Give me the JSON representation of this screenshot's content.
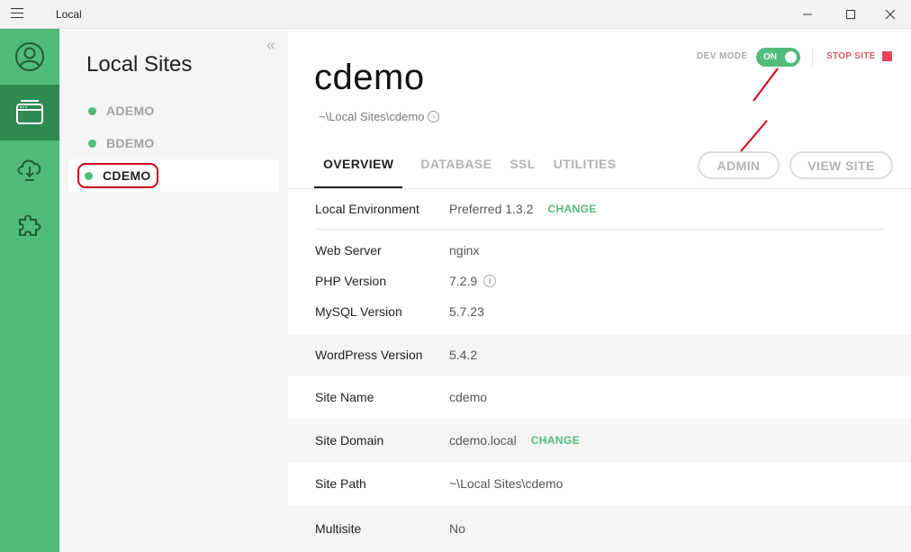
{
  "window": {
    "title": "Local"
  },
  "sidebar": {
    "heading": "Local Sites",
    "collapse_glyph": "«"
  },
  "sites": [
    {
      "name": "ADEMO"
    },
    {
      "name": "BDEMO"
    },
    {
      "name": "CDEMO"
    }
  ],
  "site": {
    "title": "cdemo",
    "path": "~\\Local Sites\\cdemo"
  },
  "header": {
    "dev_mode_label": "DEV MODE",
    "dev_mode_state": "ON",
    "stop_site_label": "STOP SITE"
  },
  "tabs": [
    "OVERVIEW",
    "DATABASE",
    "SSL",
    "UTILITIES"
  ],
  "buttons": {
    "admin": "ADMIN",
    "view_site": "VIEW SITE"
  },
  "overview": {
    "local_environment": {
      "label": "Local Environment",
      "value": "Preferred 1.3.2",
      "action": "CHANGE"
    },
    "web_server": {
      "label": "Web Server",
      "value": "nginx"
    },
    "php_version": {
      "label": "PHP Version",
      "value": "7.2.9"
    },
    "mysql_version": {
      "label": "MySQL Version",
      "value": "5.7.23"
    },
    "wordpress_version": {
      "label": "WordPress Version",
      "value": "5.4.2"
    },
    "site_name": {
      "label": "Site Name",
      "value": "cdemo"
    },
    "site_domain": {
      "label": "Site Domain",
      "value": "cdemo.local",
      "action": "CHANGE"
    },
    "site_path": {
      "label": "Site Path",
      "value": "~\\Local Sites\\cdemo"
    },
    "multisite": {
      "label": "Multisite",
      "value": "No"
    }
  },
  "colors": {
    "accent": "#51bb7b",
    "rail_active": "#2f8a51",
    "stop": "#e8415a",
    "annotation": "#d0021b"
  }
}
